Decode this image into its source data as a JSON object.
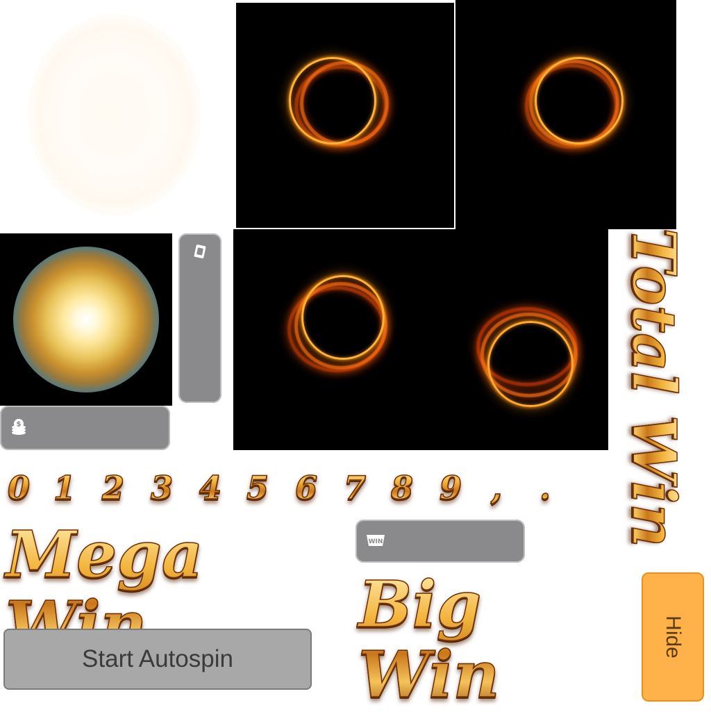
{
  "digits": [
    "0",
    "1",
    "2",
    "3",
    "4",
    "5",
    "6",
    "7",
    "8",
    "9",
    ",",
    "."
  ],
  "titles": {
    "mega_win": "Mega Win",
    "big_win": "Big Win",
    "total_win": "Total Win"
  },
  "buttons": {
    "start_autospin": "Start Autospin",
    "hide": "Hide"
  },
  "icons": {
    "coin_stack": "coin-stack-icon",
    "win_badge": "WIN",
    "card": "card-icon"
  },
  "colors": {
    "panel_grey": "#8a898b",
    "button_grey": "#a8a8a8",
    "button_orange": "#ffb14a",
    "gold": "#e8a530",
    "ring_orange": "#ffb238"
  }
}
